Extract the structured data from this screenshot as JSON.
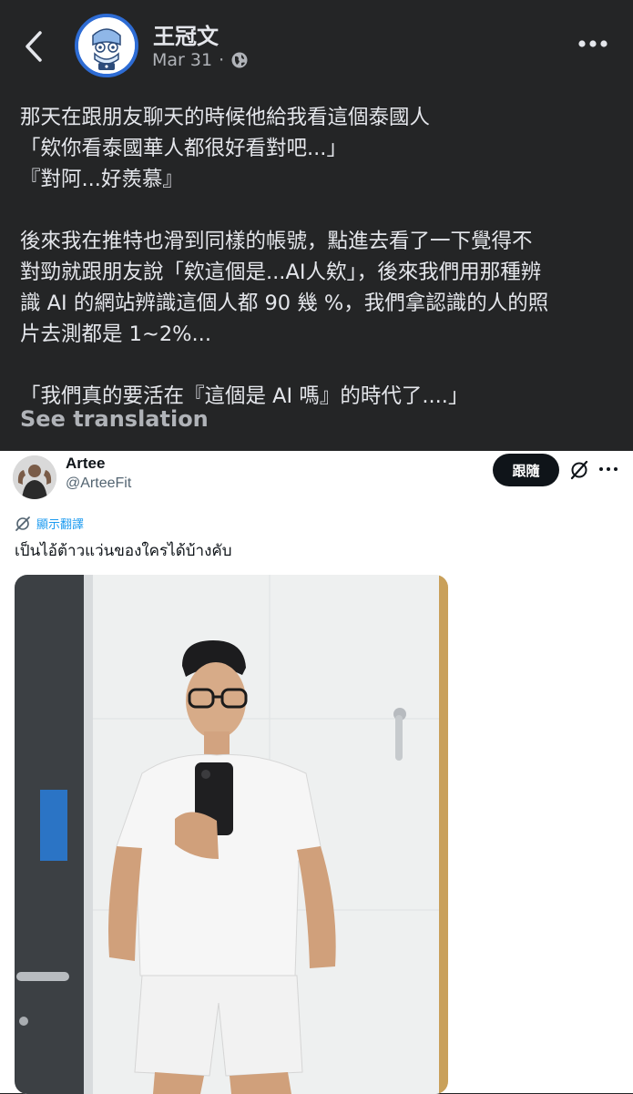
{
  "post": {
    "author": "王冠文",
    "date": "Mar 31",
    "separator": "·",
    "lines": [
      "那天在跟朋友聊天的時候他給我看這個泰國人",
      "「欸你看泰國華人都很好看對吧...」",
      "『對阿...好羨慕』",
      "",
      "後來我在推特也滑到同樣的帳號，點進去看了一下覺得不",
      "對勁就跟朋友說「欸這個是...AI人欸」，後來我們用那種辨",
      "識 AI 的網站辨識這個人都 90 幾 %，我們拿認識的人的照",
      "片去測都是 1~2%...",
      "",
      "「我們真的要活在『這個是 AI 嗎』的時代了....」"
    ],
    "see_translation": "See translation"
  },
  "tweet": {
    "name": "Artee",
    "handle": "@ArteeFit",
    "follow_label": "跟隨",
    "translate_label": "顯示翻譯",
    "text": "เป็นไอ้ต้าวแว่นของใครได้บ้างคับ"
  },
  "icons": {
    "back": "chevron-left-icon",
    "more": "more-horizontal-icon",
    "privacy": "globe-icon",
    "grok": "grok-icon",
    "tweet_more": "more-vertical-icon",
    "translate": "translate-icon"
  },
  "colors": {
    "post_bg": "#242526",
    "text_primary": "#e4e6eb",
    "text_secondary": "#b0b3b8",
    "avatar_ring": "#2e6cd4",
    "tweet_bg": "#ffffff",
    "link_blue": "#1d9bf0",
    "follow_bg": "#0f1419"
  }
}
